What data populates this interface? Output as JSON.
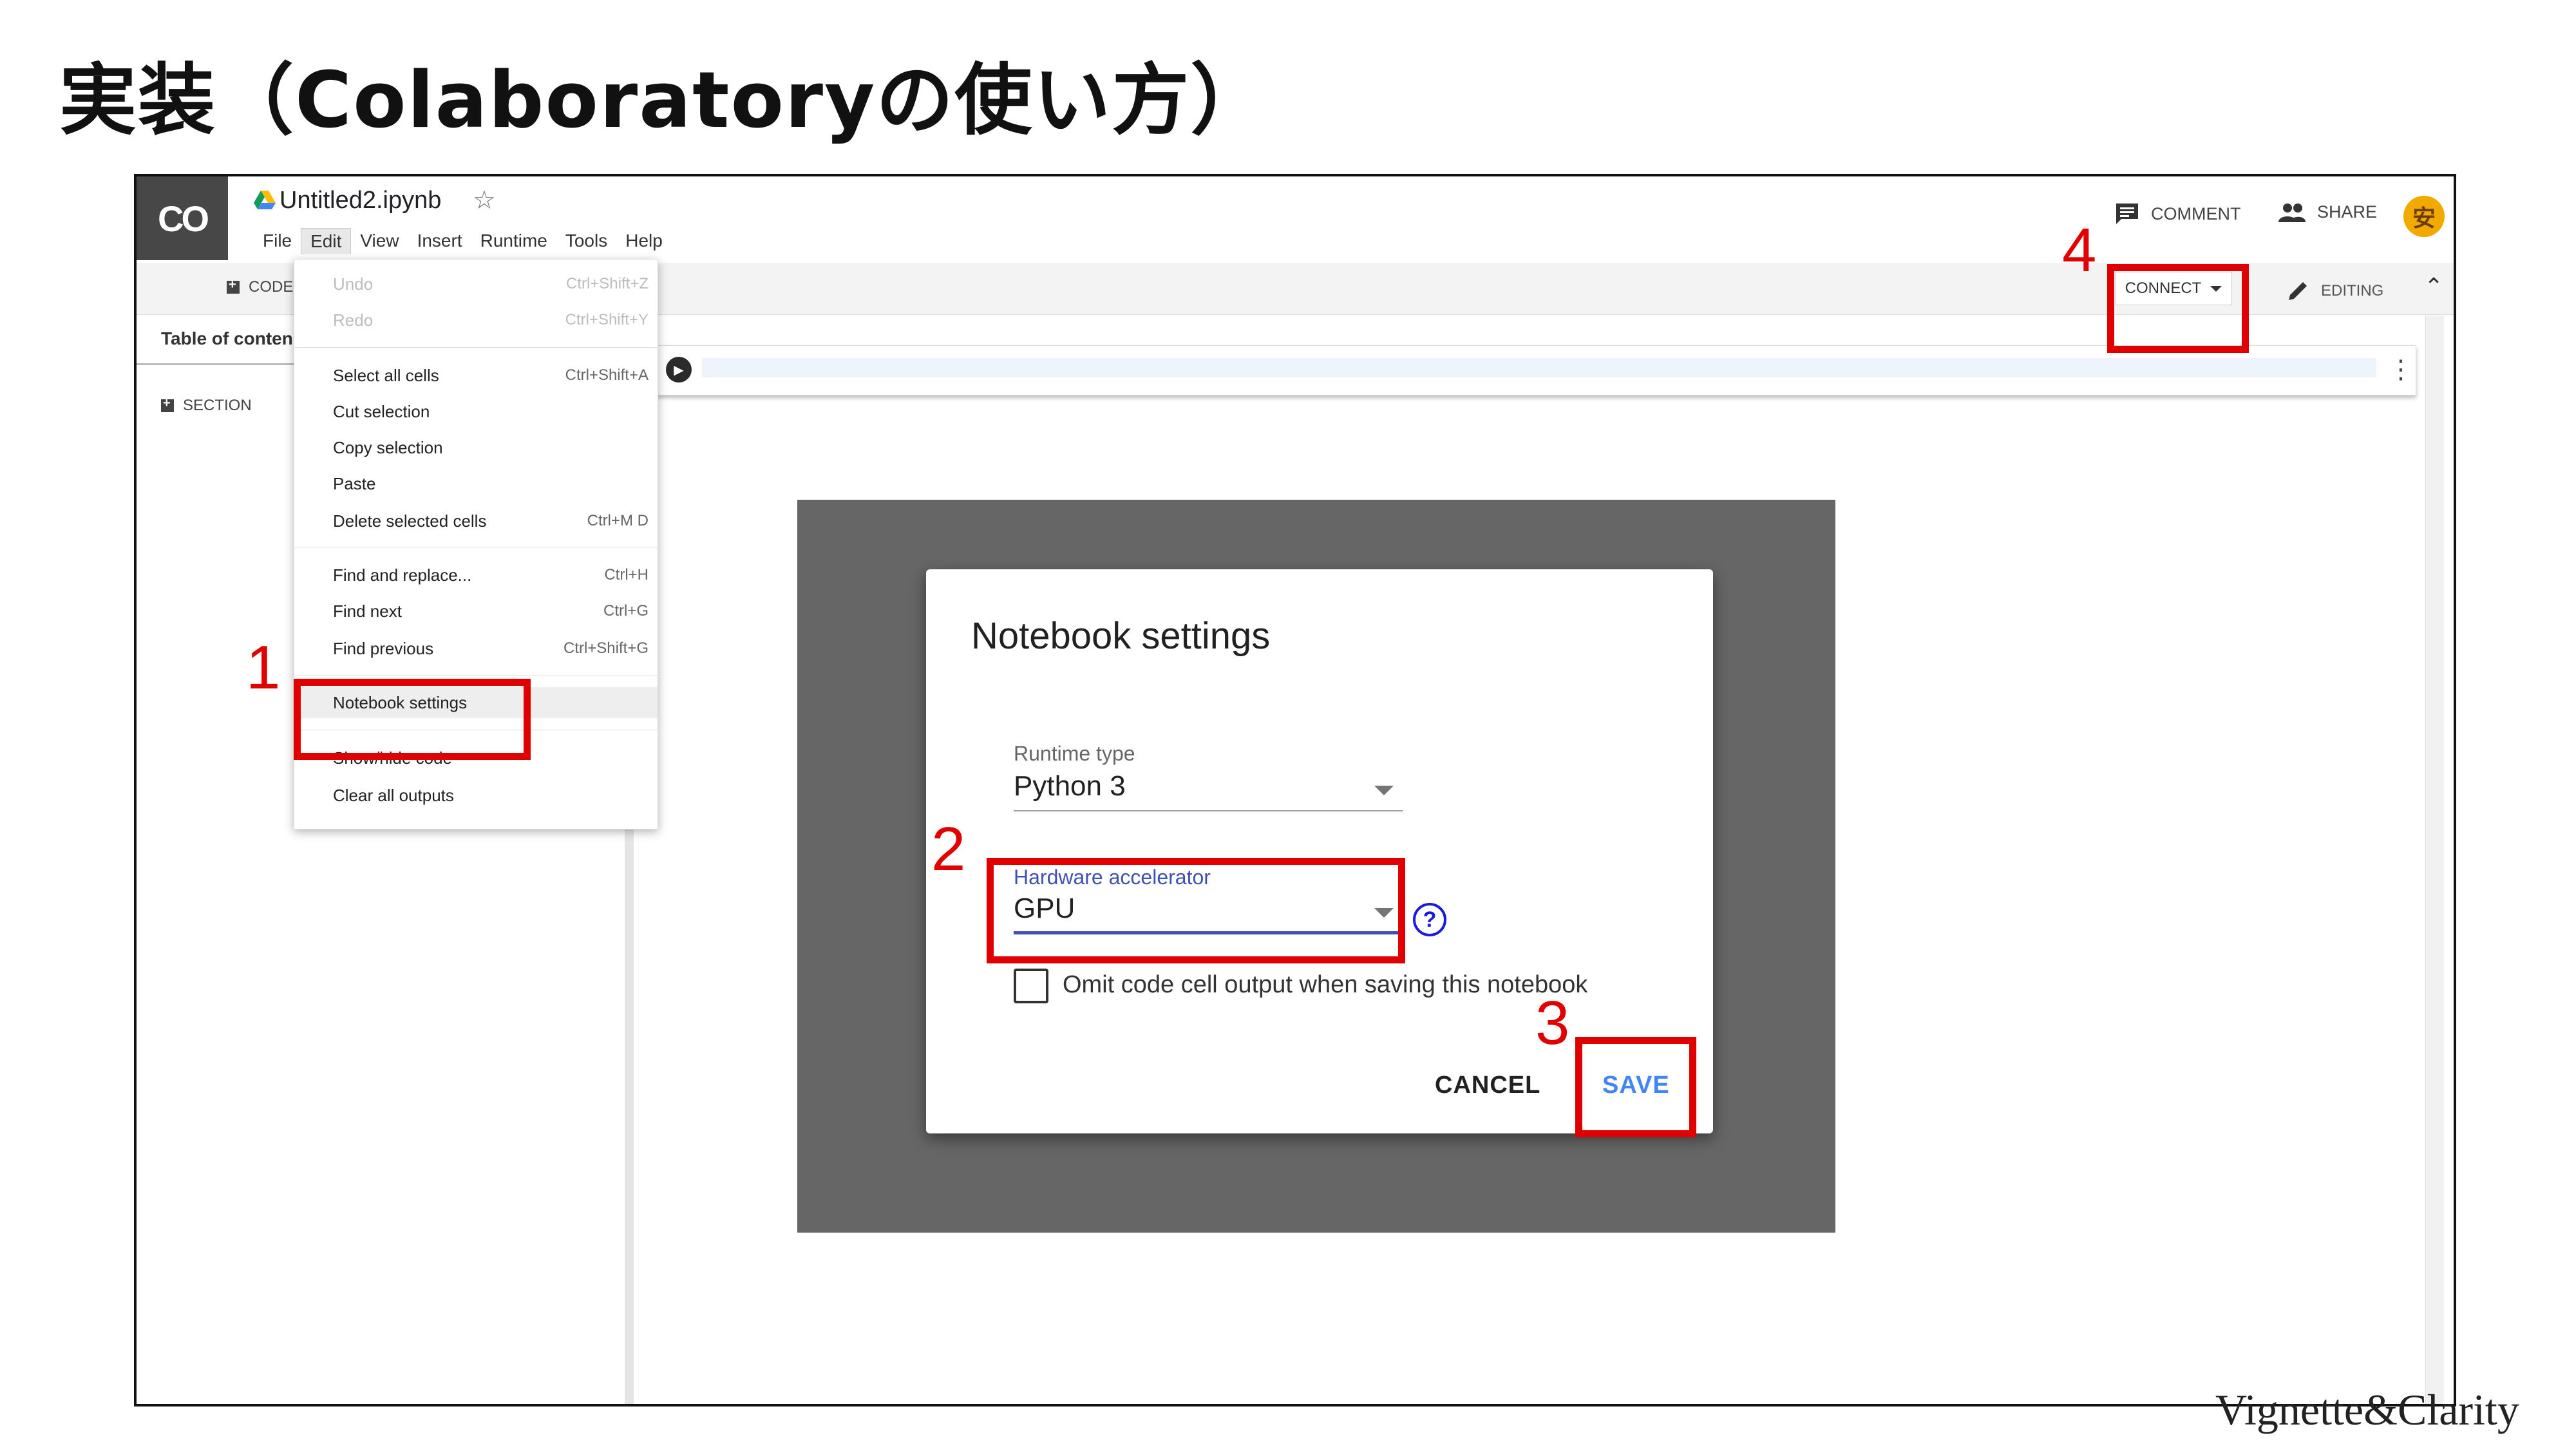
{
  "slide": {
    "title": "実装（Colaboratoryの使い方）",
    "footer": "Vignette&Clarity"
  },
  "colab": {
    "logo": "CO",
    "file_name": "Untitled2.ipynb",
    "menu": [
      "File",
      "Edit",
      "View",
      "Insert",
      "Runtime",
      "Tools",
      "Help"
    ],
    "active_menu": "Edit",
    "header": {
      "comment_label": "COMMENT",
      "share_label": "SHARE",
      "avatar_initial": "安"
    },
    "toolbar": {
      "code_label": "CODE",
      "connect_label": "CONNECT",
      "editing_label": "EDITING"
    },
    "sidebar": {
      "tab_label": "Table of conten",
      "section_label": "SECTION"
    }
  },
  "edit_menu": {
    "items": [
      {
        "label": "Undo",
        "shortcut": "Ctrl+Shift+Z",
        "disabled": true
      },
      {
        "label": "Redo",
        "shortcut": "Ctrl+Shift+Y",
        "disabled": true
      },
      {
        "label": "Select all cells",
        "shortcut": "Ctrl+Shift+A"
      },
      {
        "label": "Cut selection",
        "shortcut": ""
      },
      {
        "label": "Copy selection",
        "shortcut": ""
      },
      {
        "label": "Paste",
        "shortcut": ""
      },
      {
        "label": "Delete selected cells",
        "shortcut": "Ctrl+M D"
      },
      {
        "label": "Find and replace...",
        "shortcut": "Ctrl+H"
      },
      {
        "label": "Find next",
        "shortcut": "Ctrl+G"
      },
      {
        "label": "Find previous",
        "shortcut": "Ctrl+Shift+G"
      },
      {
        "label": "Notebook settings",
        "shortcut": "",
        "highlighted": true
      },
      {
        "label": "Show/hide code",
        "shortcut": ""
      },
      {
        "label": "Clear all outputs",
        "shortcut": ""
      }
    ]
  },
  "dialog": {
    "title": "Notebook settings",
    "runtime_type": {
      "label": "Runtime type",
      "value": "Python 3"
    },
    "hardware_accelerator": {
      "label": "Hardware accelerator",
      "value": "GPU"
    },
    "help_glyph": "?",
    "omit_output": {
      "label": "Omit code cell output when saving this notebook",
      "checked": false
    },
    "cancel_label": "CANCEL",
    "save_label": "SAVE"
  },
  "annotations": {
    "step1": "1",
    "step2": "2",
    "step3": "3",
    "step4": "4",
    "color": "#e00000"
  },
  "colors": {
    "colab_logo_bg": "#474747",
    "overlay": "#666666",
    "save_button": "#4285f4",
    "focused_field": "#3f51b5",
    "avatar": "#f2a900"
  },
  "icons": {
    "drive": "drive-icon",
    "star": "star-icon",
    "comment": "comment-icon",
    "share": "people-icon",
    "edit": "pencil-icon",
    "run": "play-icon",
    "more": "more-vert-icon",
    "collapse": "chevron-up-icon",
    "help": "help-circle-icon"
  }
}
